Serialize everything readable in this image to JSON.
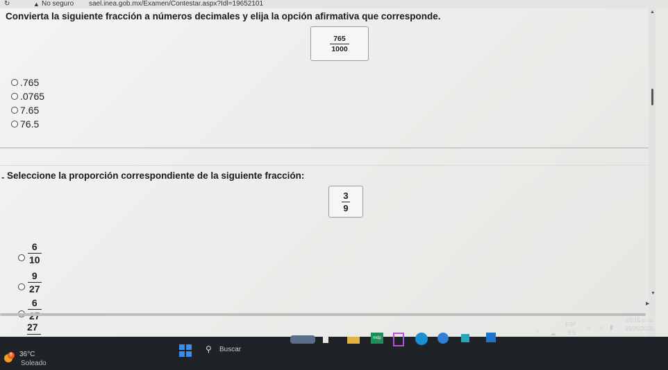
{
  "browser": {
    "security_label": "No seguro",
    "url": "sael.inea.gob.mx/Examen/Contestar.aspx?Idl=19652101",
    "reload_icon": "reload-icon",
    "warning_icon": "warning-icon"
  },
  "question1": {
    "title": "Convierta la siguiente fracción a números decimales y elija la opción afirmativa que corresponde.",
    "fraction": {
      "numerator": "765",
      "denominator": "1000"
    },
    "options": [
      ".765",
      ".0765",
      "7.65",
      "76.5"
    ]
  },
  "question2": {
    "dash": "-",
    "title": "Seleccione la proporción correspondiente de la siguiente fracción:",
    "fraction": {
      "numerator": "3",
      "denominator": "9"
    },
    "options": [
      {
        "numerator": "6",
        "denominator": "10"
      },
      {
        "numerator": "9",
        "denominator": "27"
      },
      {
        "numerator": "6",
        "denominator": "27"
      }
    ],
    "partial_option": "27"
  },
  "taskbar": {
    "weather_badge": "6",
    "temperature": "36°C",
    "weather_desc": "Soleado",
    "search_label": "Buscar",
    "mail_label": "mdp",
    "lang_top": "ESP",
    "lang_bottom": "ES",
    "time": "05:15 p. m.",
    "date": "19/05/2025"
  },
  "colors": {
    "taskbar_bg": "#1f2226",
    "page_bg": "#f0f0ee",
    "separator": "#c9a58f",
    "start_blue": "#3a8ee6"
  }
}
